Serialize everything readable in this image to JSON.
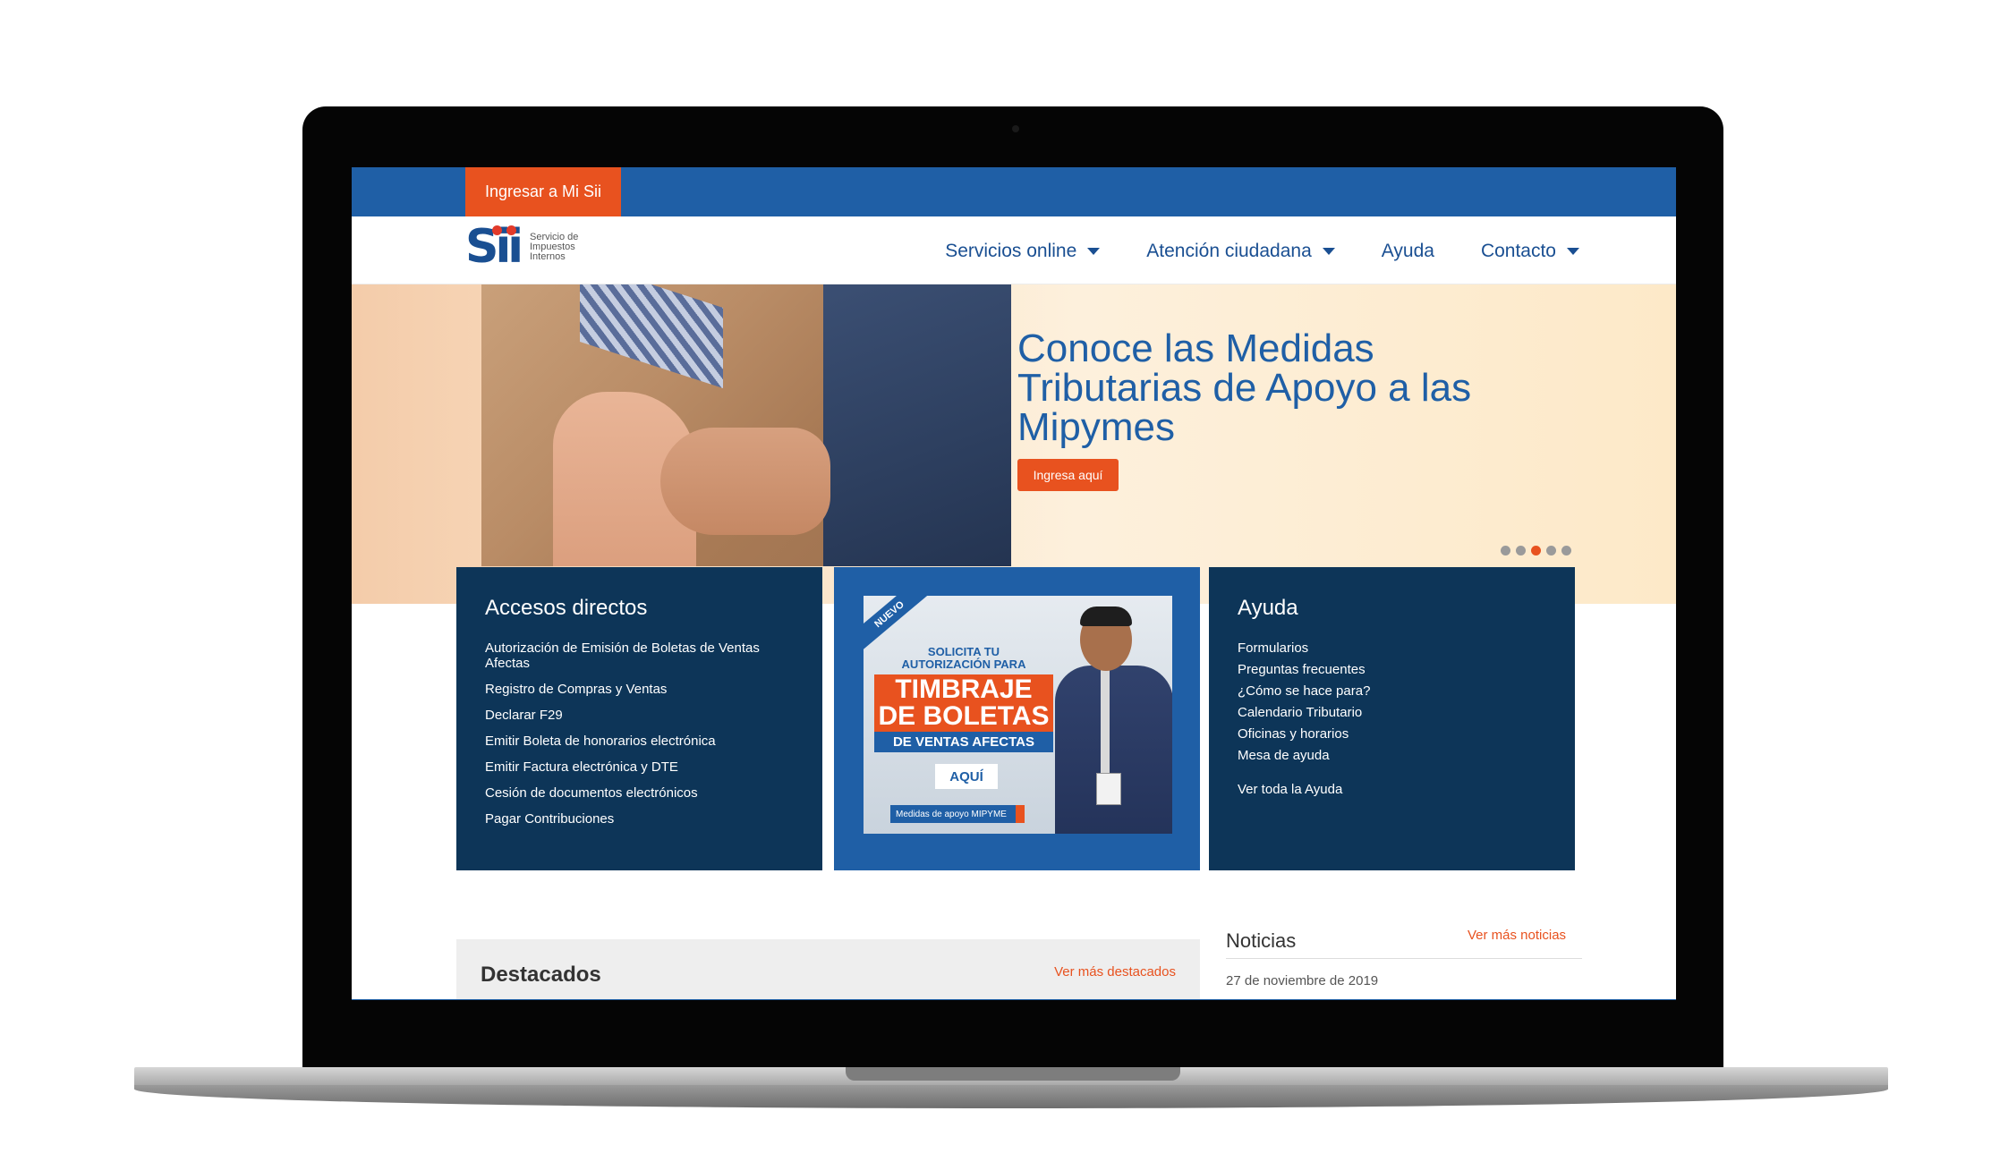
{
  "topbar": {
    "login_label": "Ingresar a Mi Sii"
  },
  "logo": {
    "mark_text": "Sii",
    "name_line1": "Servicio de",
    "name_line2": "Impuestos",
    "name_line3": "Internos"
  },
  "nav": {
    "items": [
      {
        "label": "Servicios online",
        "has_dropdown": true
      },
      {
        "label": "Atención ciudadana",
        "has_dropdown": true
      },
      {
        "label": "Ayuda",
        "has_dropdown": false
      },
      {
        "label": "Contacto",
        "has_dropdown": true
      }
    ]
  },
  "hero": {
    "title": "Conoce las Medidas Tributarias de Apoyo a las Mipymes",
    "button_label": "Ingresa aquí",
    "slides_total": 5,
    "active_slide": 3
  },
  "accesos": {
    "title": "Accesos directos",
    "items": [
      "Autorización de Emisión de Boletas de Ventas Afectas",
      "Registro de Compras y Ventas",
      "Declarar F29",
      "Emitir Boleta de honorarios electrónica",
      "Emitir Factura electrónica y DTE",
      "Cesión de documentos electrónicos",
      "Pagar Contribuciones"
    ]
  },
  "promo": {
    "badge": "NUEVO",
    "subtitle": "SOLICITA TU AUTORIZACIÓN PARA",
    "headline": "TIMBRAJE DE BOLETAS",
    "strip": "DE VENTAS AFECTAS",
    "cta": "AQUÍ",
    "footer": "Medidas de apoyo MIPYME"
  },
  "ayuda": {
    "title": "Ayuda",
    "items": [
      "Formularios",
      "Preguntas frecuentes",
      "¿Cómo se hace para?",
      "Calendario Tributario",
      "Oficinas y horarios",
      "Mesa de ayuda"
    ],
    "all_link": "Ver toda la Ayuda"
  },
  "destacados": {
    "title": "Destacados",
    "link": "Ver más destacados"
  },
  "noticias": {
    "title": "Noticias",
    "link": "Ver más noticias",
    "first_date": "27 de noviembre de 2019"
  },
  "colors": {
    "brand_blue": "#1f5fa6",
    "dark_navy": "#0d3558",
    "accent_orange": "#e8521f"
  }
}
